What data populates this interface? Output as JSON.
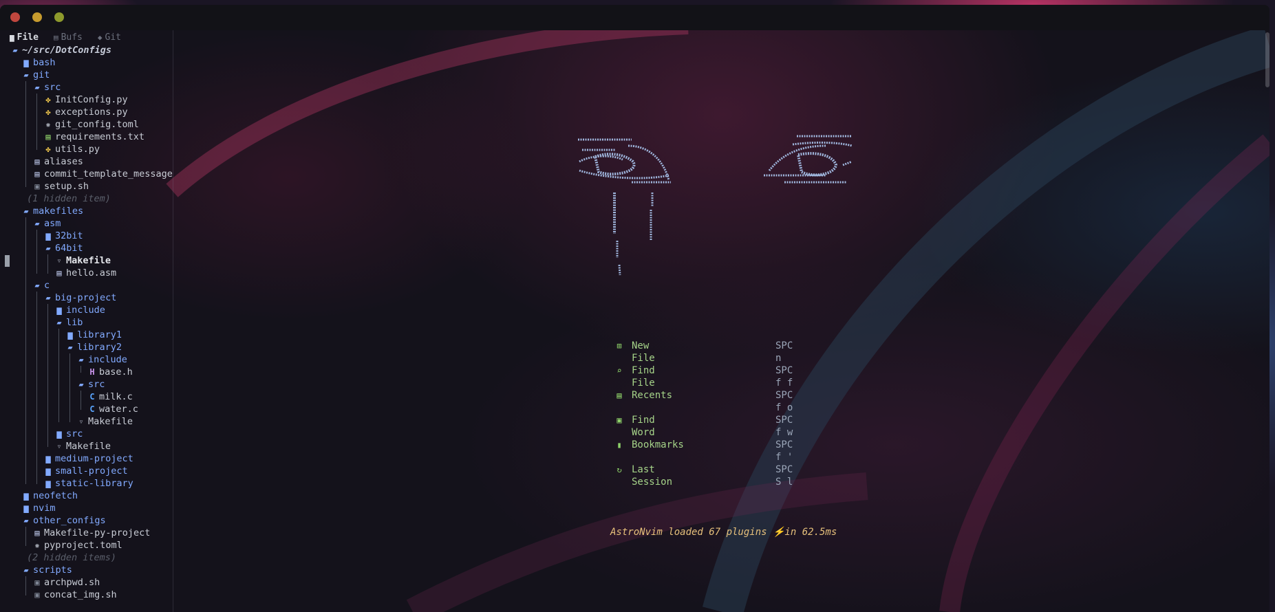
{
  "window": {
    "controls": [
      "close",
      "minimize",
      "maximize"
    ]
  },
  "sidebar": {
    "tabs": [
      {
        "label": "File",
        "icon": "folder-icon",
        "active": true
      },
      {
        "label": "Bufs",
        "icon": "file-icon",
        "active": false
      },
      {
        "label": "Git",
        "icon": "git-icon",
        "active": false
      }
    ],
    "tree": [
      {
        "label": "~/src/DotConfigs",
        "kind": "root",
        "icon": "folder-open-icon"
      },
      {
        "label": "bash",
        "kind": "dir",
        "icon": "folder-icon"
      },
      {
        "label": "git",
        "kind": "dir",
        "icon": "folder-open-icon"
      },
      {
        "label": "src",
        "kind": "dir",
        "icon": "folder-open-icon"
      },
      {
        "label": "InitConfig.py",
        "kind": "file",
        "icon": "python-icon"
      },
      {
        "label": "exceptions.py",
        "kind": "file",
        "icon": "python-icon"
      },
      {
        "label": "git_config.toml",
        "kind": "file",
        "icon": "gear-icon"
      },
      {
        "label": "requirements.txt",
        "kind": "file",
        "icon": "text-file-icon"
      },
      {
        "label": "utils.py",
        "kind": "file",
        "icon": "python-icon"
      },
      {
        "label": "aliases",
        "kind": "file",
        "icon": "document-icon"
      },
      {
        "label": "commit_template_message",
        "kind": "file",
        "icon": "document-icon"
      },
      {
        "label": "setup.sh",
        "kind": "file",
        "icon": "shell-icon"
      },
      {
        "label": "(1 hidden item)",
        "kind": "hidden"
      },
      {
        "label": "makefiles",
        "kind": "dir",
        "icon": "folder-open-icon"
      },
      {
        "label": "asm",
        "kind": "dir",
        "icon": "folder-open-icon"
      },
      {
        "label": "32bit",
        "kind": "dir",
        "icon": "folder-icon"
      },
      {
        "label": "64bit",
        "kind": "dir",
        "icon": "folder-open-icon"
      },
      {
        "label": "Makefile",
        "kind": "file",
        "icon": "makefile-icon",
        "bold": true
      },
      {
        "label": "hello.asm",
        "kind": "file",
        "icon": "document-icon"
      },
      {
        "label": "c",
        "kind": "dir",
        "icon": "folder-open-icon"
      },
      {
        "label": "big-project",
        "kind": "dir",
        "icon": "folder-open-icon"
      },
      {
        "label": "include",
        "kind": "dir",
        "icon": "folder-icon"
      },
      {
        "label": "lib",
        "kind": "dir",
        "icon": "folder-open-icon"
      },
      {
        "label": "library1",
        "kind": "dir",
        "icon": "folder-icon"
      },
      {
        "label": "library2",
        "kind": "dir",
        "icon": "folder-open-icon"
      },
      {
        "label": "include",
        "kind": "dir",
        "icon": "folder-open-icon"
      },
      {
        "label": "base.h",
        "kind": "file",
        "icon": "header-file-icon"
      },
      {
        "label": "src",
        "kind": "dir",
        "icon": "folder-open-icon"
      },
      {
        "label": "milk.c",
        "kind": "file",
        "icon": "c-file-icon"
      },
      {
        "label": "water.c",
        "kind": "file",
        "icon": "c-file-icon"
      },
      {
        "label": "Makefile",
        "kind": "file",
        "icon": "makefile-icon"
      },
      {
        "label": "src",
        "kind": "dir",
        "icon": "folder-icon"
      },
      {
        "label": "Makefile",
        "kind": "file",
        "icon": "makefile-icon"
      },
      {
        "label": "medium-project",
        "kind": "dir",
        "icon": "folder-icon"
      },
      {
        "label": "small-project",
        "kind": "dir",
        "icon": "folder-icon"
      },
      {
        "label": "static-library",
        "kind": "dir",
        "icon": "folder-icon"
      },
      {
        "label": "neofetch",
        "kind": "dir",
        "icon": "folder-icon"
      },
      {
        "label": "nvim",
        "kind": "dir",
        "icon": "folder-icon"
      },
      {
        "label": "other_configs",
        "kind": "dir",
        "icon": "folder-open-icon"
      },
      {
        "label": "Makefile-py-project",
        "kind": "file",
        "icon": "document-icon"
      },
      {
        "label": "pyproject.toml",
        "kind": "file",
        "icon": "gear-icon"
      },
      {
        "label": "(2 hidden items)",
        "kind": "hidden"
      },
      {
        "label": "scripts",
        "kind": "dir",
        "icon": "folder-open-icon"
      },
      {
        "label": "archpwd.sh",
        "kind": "file",
        "icon": "shell-icon"
      },
      {
        "label": "concat_img.sh",
        "kind": "file",
        "icon": "shell-icon"
      }
    ]
  },
  "dashboard": {
    "header_art": "eyes-ascii-art",
    "menu": [
      {
        "label": "New File",
        "key": "SPC n",
        "icon": "plus-square-icon"
      },
      {
        "label": "Find File",
        "key": "SPC f f",
        "icon": "search-icon"
      },
      {
        "label": "Recents",
        "key": "SPC f o",
        "icon": "file-icon"
      },
      {
        "label": "Find Word",
        "key": "SPC f w",
        "icon": "word-icon"
      },
      {
        "label": "Bookmarks",
        "key": "SPC f '",
        "icon": "bookmark-icon"
      },
      {
        "label": "Last Session",
        "key": "SPC S l",
        "icon": "refresh-icon"
      }
    ],
    "footer": "AstroNvim loaded 67 plugins ⚡in 62.5ms"
  },
  "colors": {
    "folder": "#82aaff",
    "menu_label": "#a6d489",
    "footer": "#e6c07b",
    "art": "#9fb6dd"
  }
}
